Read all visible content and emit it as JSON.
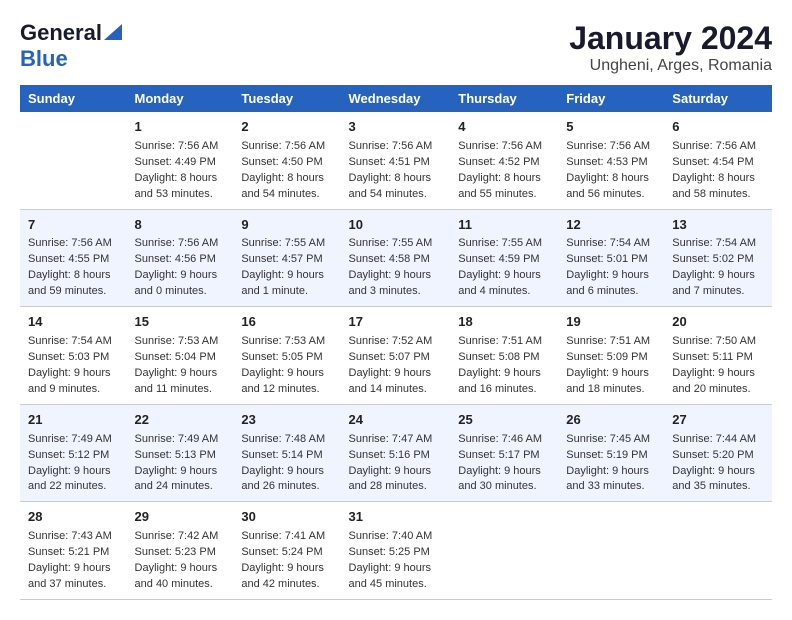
{
  "logo": {
    "general": "General",
    "blue": "Blue"
  },
  "title": "January 2024",
  "location": "Ungheni, Arges, Romania",
  "days_of_week": [
    "Sunday",
    "Monday",
    "Tuesday",
    "Wednesday",
    "Thursday",
    "Friday",
    "Saturday"
  ],
  "weeks": [
    [
      {
        "day": "",
        "sunrise": "",
        "sunset": "",
        "daylight": ""
      },
      {
        "day": "1",
        "sunrise": "Sunrise: 7:56 AM",
        "sunset": "Sunset: 4:49 PM",
        "daylight": "Daylight: 8 hours and 53 minutes."
      },
      {
        "day": "2",
        "sunrise": "Sunrise: 7:56 AM",
        "sunset": "Sunset: 4:50 PM",
        "daylight": "Daylight: 8 hours and 54 minutes."
      },
      {
        "day": "3",
        "sunrise": "Sunrise: 7:56 AM",
        "sunset": "Sunset: 4:51 PM",
        "daylight": "Daylight: 8 hours and 54 minutes."
      },
      {
        "day": "4",
        "sunrise": "Sunrise: 7:56 AM",
        "sunset": "Sunset: 4:52 PM",
        "daylight": "Daylight: 8 hours and 55 minutes."
      },
      {
        "day": "5",
        "sunrise": "Sunrise: 7:56 AM",
        "sunset": "Sunset: 4:53 PM",
        "daylight": "Daylight: 8 hours and 56 minutes."
      },
      {
        "day": "6",
        "sunrise": "Sunrise: 7:56 AM",
        "sunset": "Sunset: 4:54 PM",
        "daylight": "Daylight: 8 hours and 58 minutes."
      }
    ],
    [
      {
        "day": "7",
        "sunrise": "Sunrise: 7:56 AM",
        "sunset": "Sunset: 4:55 PM",
        "daylight": "Daylight: 8 hours and 59 minutes."
      },
      {
        "day": "8",
        "sunrise": "Sunrise: 7:56 AM",
        "sunset": "Sunset: 4:56 PM",
        "daylight": "Daylight: 9 hours and 0 minutes."
      },
      {
        "day": "9",
        "sunrise": "Sunrise: 7:55 AM",
        "sunset": "Sunset: 4:57 PM",
        "daylight": "Daylight: 9 hours and 1 minute."
      },
      {
        "day": "10",
        "sunrise": "Sunrise: 7:55 AM",
        "sunset": "Sunset: 4:58 PM",
        "daylight": "Daylight: 9 hours and 3 minutes."
      },
      {
        "day": "11",
        "sunrise": "Sunrise: 7:55 AM",
        "sunset": "Sunset: 4:59 PM",
        "daylight": "Daylight: 9 hours and 4 minutes."
      },
      {
        "day": "12",
        "sunrise": "Sunrise: 7:54 AM",
        "sunset": "Sunset: 5:01 PM",
        "daylight": "Daylight: 9 hours and 6 minutes."
      },
      {
        "day": "13",
        "sunrise": "Sunrise: 7:54 AM",
        "sunset": "Sunset: 5:02 PM",
        "daylight": "Daylight: 9 hours and 7 minutes."
      }
    ],
    [
      {
        "day": "14",
        "sunrise": "Sunrise: 7:54 AM",
        "sunset": "Sunset: 5:03 PM",
        "daylight": "Daylight: 9 hours and 9 minutes."
      },
      {
        "day": "15",
        "sunrise": "Sunrise: 7:53 AM",
        "sunset": "Sunset: 5:04 PM",
        "daylight": "Daylight: 9 hours and 11 minutes."
      },
      {
        "day": "16",
        "sunrise": "Sunrise: 7:53 AM",
        "sunset": "Sunset: 5:05 PM",
        "daylight": "Daylight: 9 hours and 12 minutes."
      },
      {
        "day": "17",
        "sunrise": "Sunrise: 7:52 AM",
        "sunset": "Sunset: 5:07 PM",
        "daylight": "Daylight: 9 hours and 14 minutes."
      },
      {
        "day": "18",
        "sunrise": "Sunrise: 7:51 AM",
        "sunset": "Sunset: 5:08 PM",
        "daylight": "Daylight: 9 hours and 16 minutes."
      },
      {
        "day": "19",
        "sunrise": "Sunrise: 7:51 AM",
        "sunset": "Sunset: 5:09 PM",
        "daylight": "Daylight: 9 hours and 18 minutes."
      },
      {
        "day": "20",
        "sunrise": "Sunrise: 7:50 AM",
        "sunset": "Sunset: 5:11 PM",
        "daylight": "Daylight: 9 hours and 20 minutes."
      }
    ],
    [
      {
        "day": "21",
        "sunrise": "Sunrise: 7:49 AM",
        "sunset": "Sunset: 5:12 PM",
        "daylight": "Daylight: 9 hours and 22 minutes."
      },
      {
        "day": "22",
        "sunrise": "Sunrise: 7:49 AM",
        "sunset": "Sunset: 5:13 PM",
        "daylight": "Daylight: 9 hours and 24 minutes."
      },
      {
        "day": "23",
        "sunrise": "Sunrise: 7:48 AM",
        "sunset": "Sunset: 5:14 PM",
        "daylight": "Daylight: 9 hours and 26 minutes."
      },
      {
        "day": "24",
        "sunrise": "Sunrise: 7:47 AM",
        "sunset": "Sunset: 5:16 PM",
        "daylight": "Daylight: 9 hours and 28 minutes."
      },
      {
        "day": "25",
        "sunrise": "Sunrise: 7:46 AM",
        "sunset": "Sunset: 5:17 PM",
        "daylight": "Daylight: 9 hours and 30 minutes."
      },
      {
        "day": "26",
        "sunrise": "Sunrise: 7:45 AM",
        "sunset": "Sunset: 5:19 PM",
        "daylight": "Daylight: 9 hours and 33 minutes."
      },
      {
        "day": "27",
        "sunrise": "Sunrise: 7:44 AM",
        "sunset": "Sunset: 5:20 PM",
        "daylight": "Daylight: 9 hours and 35 minutes."
      }
    ],
    [
      {
        "day": "28",
        "sunrise": "Sunrise: 7:43 AM",
        "sunset": "Sunset: 5:21 PM",
        "daylight": "Daylight: 9 hours and 37 minutes."
      },
      {
        "day": "29",
        "sunrise": "Sunrise: 7:42 AM",
        "sunset": "Sunset: 5:23 PM",
        "daylight": "Daylight: 9 hours and 40 minutes."
      },
      {
        "day": "30",
        "sunrise": "Sunrise: 7:41 AM",
        "sunset": "Sunset: 5:24 PM",
        "daylight": "Daylight: 9 hours and 42 minutes."
      },
      {
        "day": "31",
        "sunrise": "Sunrise: 7:40 AM",
        "sunset": "Sunset: 5:25 PM",
        "daylight": "Daylight: 9 hours and 45 minutes."
      },
      {
        "day": "",
        "sunrise": "",
        "sunset": "",
        "daylight": ""
      },
      {
        "day": "",
        "sunrise": "",
        "sunset": "",
        "daylight": ""
      },
      {
        "day": "",
        "sunrise": "",
        "sunset": "",
        "daylight": ""
      }
    ]
  ]
}
